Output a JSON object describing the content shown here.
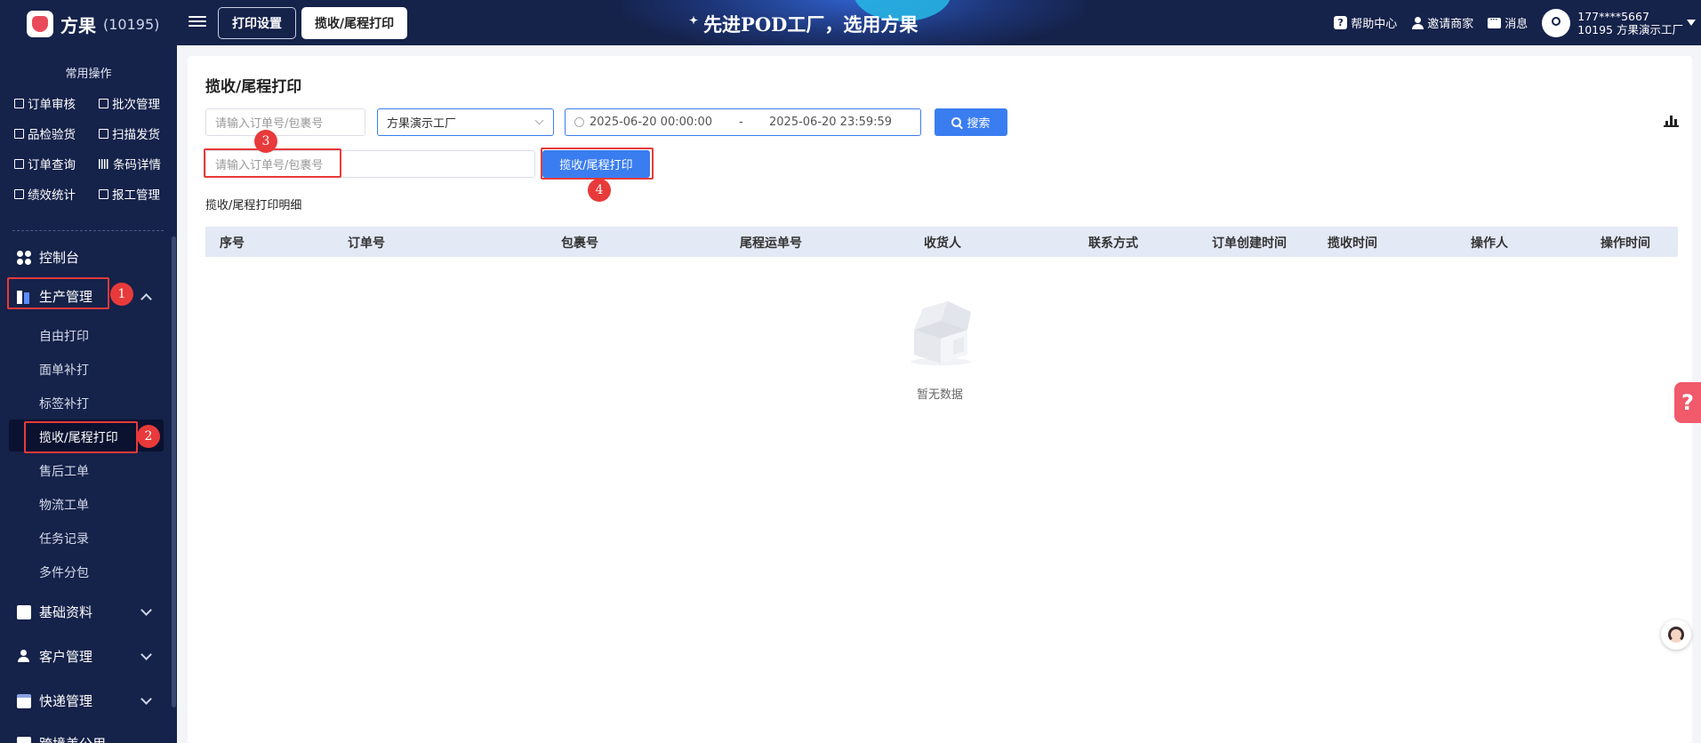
{
  "header": {
    "brand": "方果",
    "brand_id": "(10195)",
    "tabs": [
      {
        "label": "打印设置"
      },
      {
        "label": "揽收/尾程打印"
      }
    ],
    "slogan": "先进POD工厂，选用方果",
    "help_center": "帮助中心",
    "invite_merchant": "邀请商家",
    "messages": "消息",
    "user_phone": "177****5667",
    "user_factory": "10195 方果演示工厂"
  },
  "sidebar": {
    "common_title": "常用操作",
    "quick_actions": [
      "订单审核",
      "批次管理",
      "品检验货",
      "扫描发货",
      "订单查询",
      "条码详情",
      "绩效统计",
      "报工管理"
    ],
    "nav": {
      "dashboard": "控制台",
      "production": "生产管理",
      "production_items": [
        "自由打印",
        "面单补打",
        "标签补打",
        "揽收/尾程打印",
        "售后工单",
        "物流工单",
        "任务记录",
        "多件分包"
      ],
      "basic_data": "基础资料",
      "customer": "客户管理",
      "express": "快递管理",
      "cut_off": "跨境美公用"
    }
  },
  "steps": [
    "1",
    "2",
    "3",
    "4"
  ],
  "main": {
    "title": "揽收/尾程打印",
    "filter": {
      "order_placeholder": "请输入订单号/包裹号",
      "factory_value": "方果演示工厂",
      "date_start": "2025-06-20 00:00:00",
      "date_sep": "-",
      "date_end": "2025-06-20 23:59:59",
      "search_label": "搜索"
    },
    "scan": {
      "placeholder": "请输入订单号/包裹号",
      "print_label": "揽收/尾程打印"
    },
    "detail_title": "揽收/尾程打印明细",
    "columns": [
      "序号",
      "订单号",
      "包裹号",
      "尾程运单号",
      "收货人",
      "联系方式",
      "订单创建时间",
      "揽收时间",
      "操作人",
      "操作时间"
    ],
    "empty_text": "暂无数据"
  },
  "colors": {
    "nav_bg": "#15224a",
    "accent": "#3a7df0",
    "highlight": "#e83a3a"
  }
}
